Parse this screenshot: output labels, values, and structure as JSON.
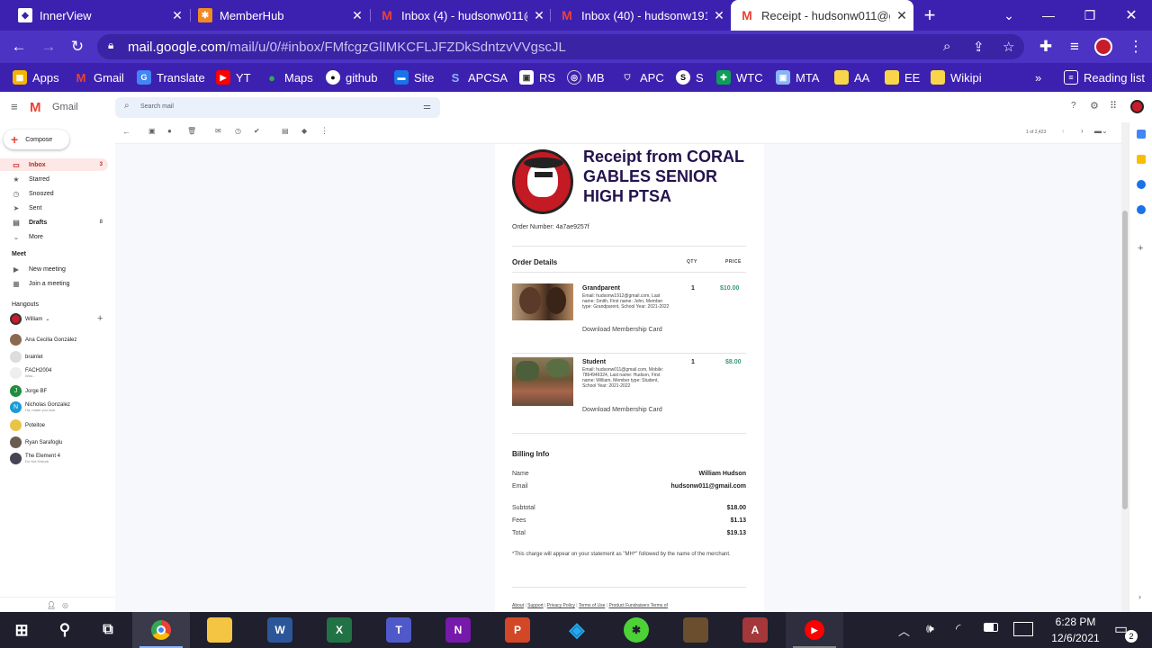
{
  "browser": {
    "tabs": [
      {
        "title": "InnerView",
        "active": false
      },
      {
        "title": "MemberHub",
        "active": false
      },
      {
        "title": "Inbox (4) - hudsonw011@",
        "active": false
      },
      {
        "title": "Inbox (40) - hudsonw1912",
        "active": false
      },
      {
        "title": "Receipt - hudsonw011@g",
        "active": true
      }
    ],
    "url_host": "mail.google.com",
    "url_path": "/mail/u/0/#inbox/FMfcgzGlIMKCFLJFZDkSdntzvVVgscJL",
    "bookmarks": [
      "Apps",
      "Gmail",
      "Translate",
      "YT",
      "Maps",
      "github",
      "Site",
      "APCSA",
      "RS",
      "MB",
      "APC",
      "S",
      "WTC",
      "MTA",
      "AA",
      "EE",
      "Wikipi"
    ],
    "reading_list": "Reading list",
    "overflow": "»"
  },
  "gmail": {
    "logo_text": "Gmail",
    "search_placeholder": "Search mail",
    "compose": "Compose",
    "pagination": "1 of 2,423",
    "nav": [
      {
        "label": "Inbox",
        "count": "3",
        "icon": "inbox-icon"
      },
      {
        "label": "Starred",
        "count": "",
        "icon": "star-icon"
      },
      {
        "label": "Snoozed",
        "count": "",
        "icon": "clock-icon"
      },
      {
        "label": "Sent",
        "count": "",
        "icon": "send-icon"
      },
      {
        "label": "Drafts",
        "count": "8",
        "icon": "draft-icon"
      },
      {
        "label": "More",
        "count": "",
        "icon": "chevron-down-icon"
      }
    ],
    "meet": {
      "heading": "Meet",
      "new_meeting": "New meeting",
      "join": "Join a meeting"
    },
    "hangouts": {
      "heading": "Hangouts",
      "self": "William",
      "contacts": [
        {
          "name": "Ana Cecilia González",
          "status": ""
        },
        {
          "name": "brainlet",
          "status": ""
        },
        {
          "name": "FACH2004",
          "status": "Woo..."
        },
        {
          "name": "Jorge BF",
          "status": ""
        },
        {
          "name": "Nicholas Gonzalez",
          "status": "Ha, made you look"
        },
        {
          "name": "Poteitoe",
          "status": ""
        },
        {
          "name": "Ryan Sarafoglu",
          "status": ""
        },
        {
          "name": "The Element 4",
          "status": "Do Not Disturb"
        }
      ]
    }
  },
  "receipt": {
    "title": "Receipt from CORAL GABLES SENIOR HIGH PTSA",
    "order_number": "Order Number: 4a7ae9257f",
    "details_heading": "Order Details",
    "qty_header": "QTY",
    "price_header": "PRICE",
    "items": [
      {
        "name": "Grandparent",
        "desc": "Email: hudsonw1912@gmail.com, Last name: Smith, First name: John, Member type: Grandparent, School Year: 2021-2022",
        "link": "Download Membership Card",
        "qty": "1",
        "price": "$10.00"
      },
      {
        "name": "Student",
        "desc": "Email: hudsonw011@gmail.com, Mobile: 7864949324, Last name: Hudson, First name: William, Member type: Student, School Year: 2021-2022",
        "link": "Download Membership Card",
        "qty": "1",
        "price": "$8.00"
      }
    ],
    "billing_heading": "Billing Info",
    "name_label": "Name",
    "name_value": "William Hudson",
    "email_label": "Email",
    "email_value": "hudsonw011@gmail.com",
    "subtotal_label": "Subtotal",
    "subtotal": "$18.00",
    "fees_label": "Fees",
    "fees": "$1.13",
    "total_label": "Total",
    "total": "$19.13",
    "note": "*This charge will appear on your statement as \"MH*\" followed by the name of the merchant.",
    "footer_links": [
      "About",
      "Support",
      "Privacy Policy",
      "Terms of Use",
      "Product Fundraisers Terms of"
    ]
  },
  "taskbar": {
    "time": "6:28 PM",
    "date": "12/6/2021",
    "notifications": "2"
  },
  "colors": {
    "tab_bar": "#3c21b0",
    "toolbar": "#4c33c4",
    "price_green": "#3a9b74",
    "receipt_title": "#23134d"
  }
}
